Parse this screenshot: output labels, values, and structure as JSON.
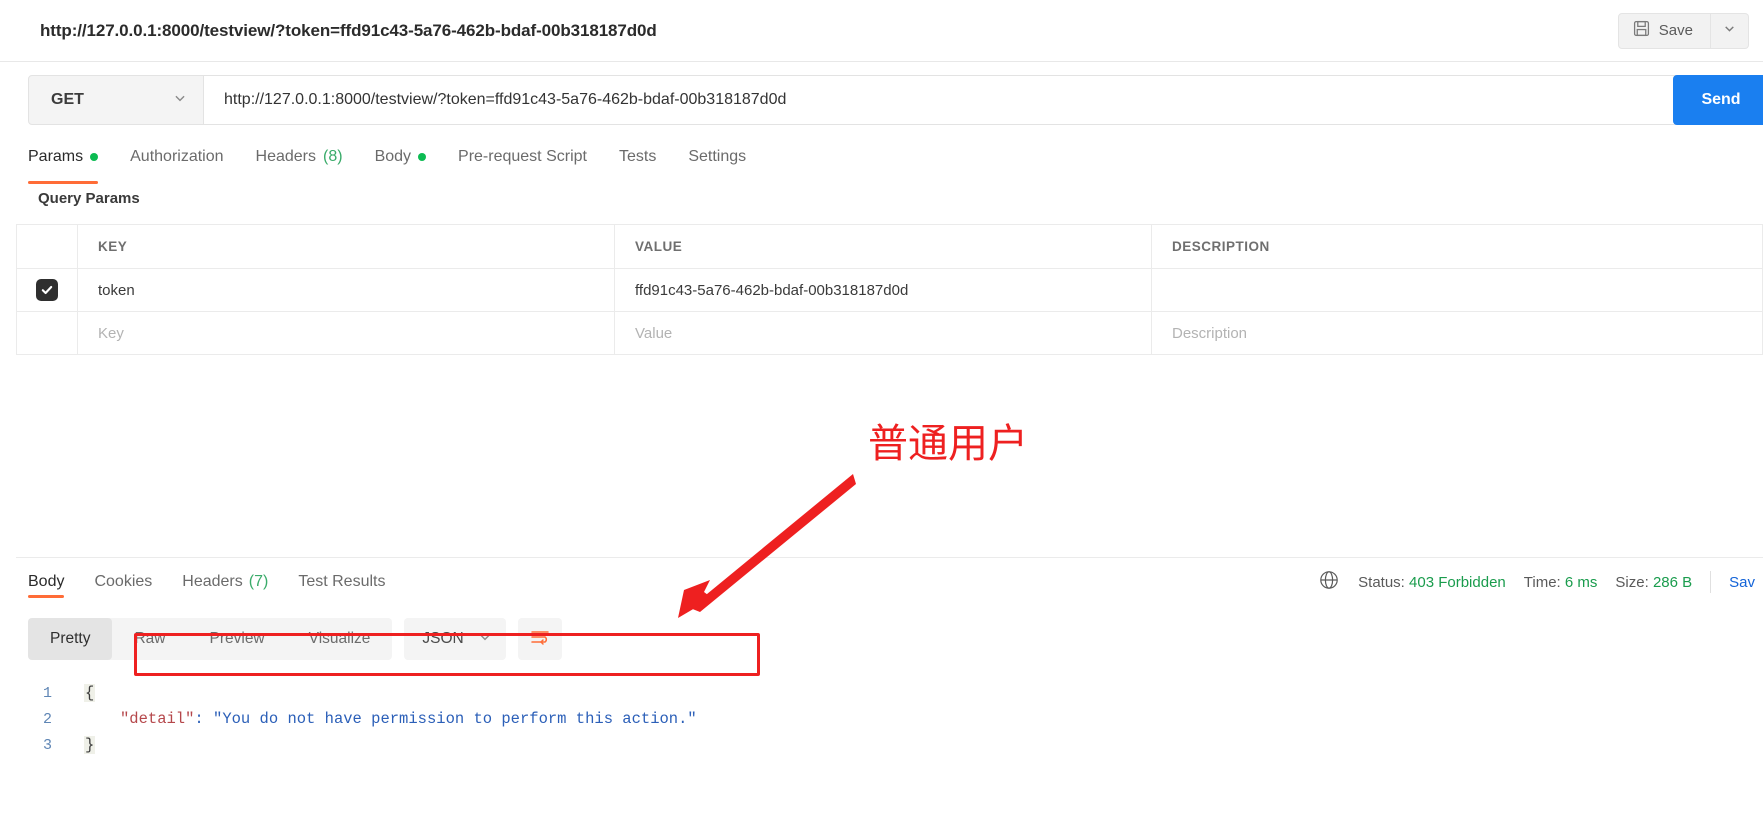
{
  "topbar": {
    "request_title": "http://127.0.0.1:8000/testview/?token=ffd91c43-5a76-462b-bdaf-00b318187d0d",
    "save_label": "Save",
    "save_icon": "floppy-disk-icon",
    "caret_icon": "chevron-down-icon"
  },
  "url_row": {
    "method": "GET",
    "method_caret_icon": "chevron-down-icon",
    "url": "http://127.0.0.1:8000/testview/?token=ffd91c43-5a76-462b-bdaf-00b318187d0d",
    "send_label": "Send"
  },
  "request_tabs": [
    {
      "label": "Params",
      "badge": "",
      "dot": true,
      "active": true
    },
    {
      "label": "Authorization",
      "badge": "",
      "dot": false,
      "active": false
    },
    {
      "label": "Headers",
      "badge": "(8)",
      "dot": false,
      "active": false
    },
    {
      "label": "Body",
      "badge": "",
      "dot": true,
      "active": false
    },
    {
      "label": "Pre-request Script",
      "badge": "",
      "dot": false,
      "active": false
    },
    {
      "label": "Tests",
      "badge": "",
      "dot": false,
      "active": false
    },
    {
      "label": "Settings",
      "badge": "",
      "dot": false,
      "active": false
    }
  ],
  "query_params": {
    "section_label": "Query Params",
    "columns": [
      "KEY",
      "VALUE",
      "DESCRIPTION"
    ],
    "rows": [
      {
        "checked": true,
        "key": "token",
        "value": "ffd91c43-5a76-462b-bdaf-00b318187d0d",
        "description": ""
      }
    ],
    "placeholder_row": {
      "key": "Key",
      "value": "Value",
      "description": "Description"
    }
  },
  "response_tabs": [
    {
      "label": "Body",
      "badge": "",
      "active": true
    },
    {
      "label": "Cookies",
      "badge": "",
      "active": false
    },
    {
      "label": "Headers",
      "badge": "(7)",
      "active": false
    },
    {
      "label": "Test Results",
      "badge": "",
      "active": false
    }
  ],
  "response_status": {
    "globe_icon": "globe-icon",
    "status_label": "Status:",
    "status_value": "403 Forbidden",
    "time_label": "Time:",
    "time_value": "6 ms",
    "size_label": "Size:",
    "size_value": "286 B",
    "save_response_label": "Sav"
  },
  "viewer_toolbar": {
    "modes": [
      "Pretty",
      "Raw",
      "Preview",
      "Visualize"
    ],
    "active_mode": "Pretty",
    "format": "JSON",
    "format_caret_icon": "chevron-down-icon",
    "wrap_icon": "word-wrap-icon"
  },
  "response_body": {
    "lines": [
      {
        "num": "1",
        "brace": "{",
        "content": ""
      },
      {
        "num": "2",
        "brace": "",
        "key": "\"detail\"",
        "colon": ": ",
        "value": "\"You do not have permission to perform this action.\""
      },
      {
        "num": "3",
        "brace": "}",
        "content": ""
      }
    ]
  },
  "annotations": {
    "label": "普通用户",
    "arrow": "red-arrow-icon",
    "highlight_box": "red-highlight-box",
    "color": "#ee2020"
  }
}
